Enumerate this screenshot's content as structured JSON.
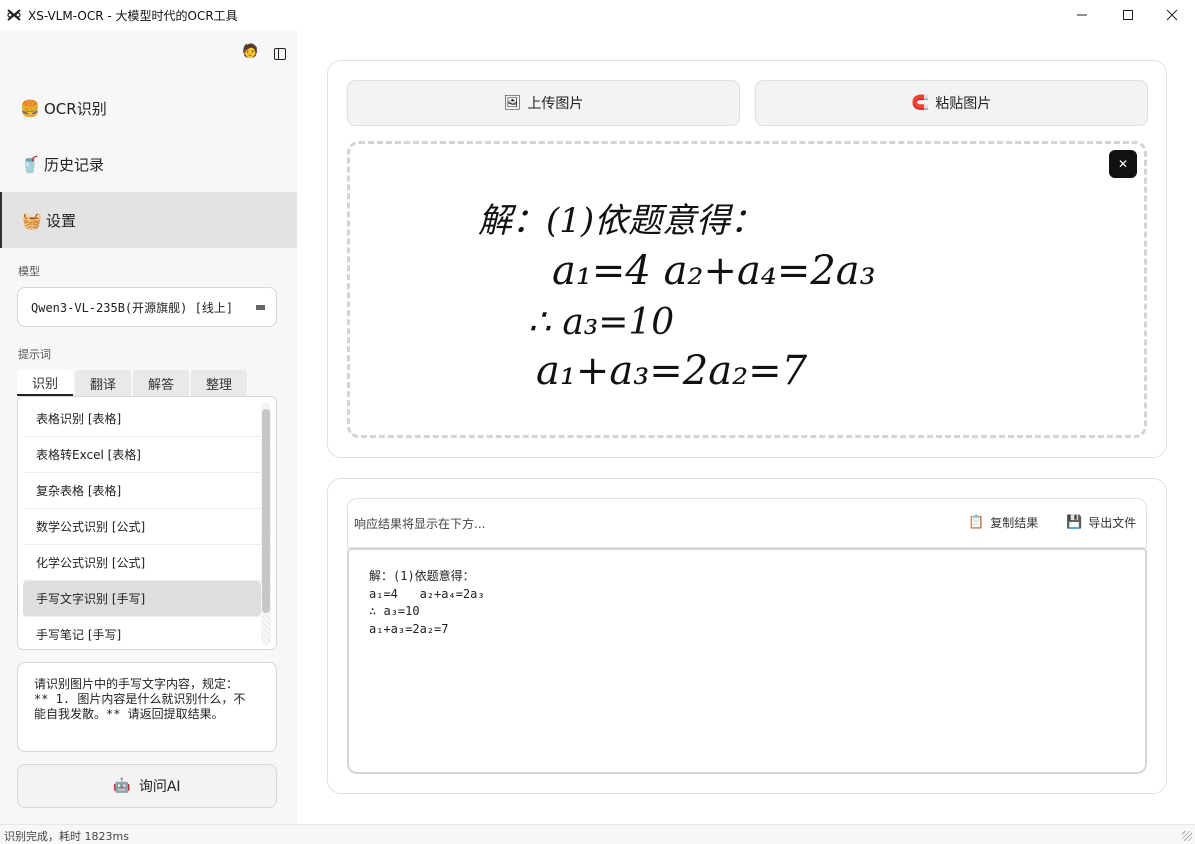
{
  "window": {
    "title": "XS-VLM-OCR - 大模型时代的OCR工具",
    "controls": [
      "minimize-icon",
      "maximize-icon",
      "close-icon"
    ]
  },
  "sidebar": {
    "tools": {
      "avatar_icon": "🧑",
      "layout_icon": "sidebar-toggle-icon"
    },
    "nav": [
      {
        "emoji": "🍔",
        "label": "OCR识别"
      },
      {
        "emoji": "🥤",
        "label": "历史记录"
      },
      {
        "emoji": "🧺",
        "label": "设置"
      }
    ],
    "model_label": "模型",
    "model_value": "Qwen3-VL-235B(开源旗舰) [线上]",
    "prompt_label": "提示词",
    "prompt_tabs": [
      "识别",
      "翻译",
      "解答",
      "整理"
    ],
    "prompt_items": [
      "表格识别 [表格]",
      "表格转Excel [表格]",
      "复杂表格 [表格]",
      "数学公式识别 [公式]",
      "化学公式识别 [公式]",
      "手写文字识别 [手写]",
      "手写笔记 [手写]"
    ],
    "prompt_text": [
      "请识别图片中的手写文字内容，规定：",
      "** 1. 图片内容是什么就识别什么，不",
      "能自我发散。**  请返回提取结果。"
    ],
    "ask_button": {
      "emoji": "🤖",
      "label": "询问AI"
    }
  },
  "main": {
    "upload_button": {
      "emoji": "🖼",
      "label": "上传图片"
    },
    "paste_button": {
      "emoji": "🧲",
      "label": "粘贴图片"
    },
    "close_label": "✕",
    "handwriting": {
      "line1": "解：(1)依题意得：",
      "line2": "a₁=4   a₂+a₄=2a₃",
      "line3": "∴ a₃=10",
      "line4": "a₁+a₃=2a₂=7"
    },
    "result_placeholder": "响应结果将显示在下方...",
    "copy_button": {
      "emoji": "📋",
      "label": "复制结果"
    },
    "export_button": {
      "emoji": "💾",
      "label": "导出文件"
    },
    "result_lines": [
      "解：(1)依题意得：",
      "a₁=4   a₂+a₄=2a₃",
      "∴ a₃=10",
      "a₁+a₃=2a₂=7"
    ]
  },
  "status": {
    "text": "识别完成，耗时 1823ms"
  }
}
